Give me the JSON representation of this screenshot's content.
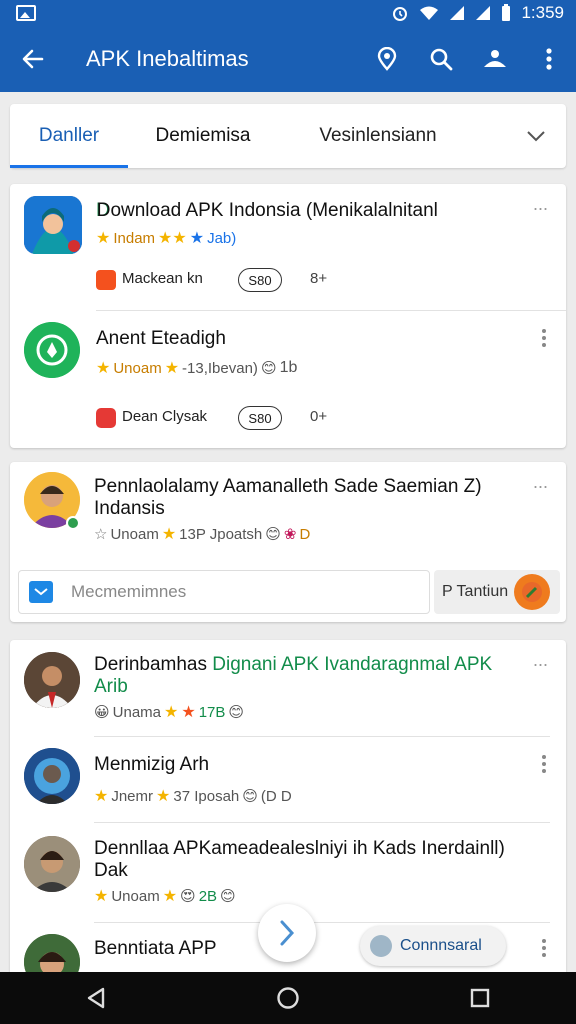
{
  "status_bar": {
    "time": "1:359"
  },
  "app_bar": {
    "title": "APK Inebaltimas"
  },
  "tabs": [
    {
      "label": "Danller"
    },
    {
      "label": "Demiemisa"
    },
    {
      "label": "Vesinlensiann"
    }
  ],
  "card1": {
    "item1": {
      "title": "Download APK Indonsia (Menikalalnitanl",
      "meta": "Indam",
      "meta_value": "Jab)",
      "row_label": "Mackean  kn",
      "pill": "S80",
      "count": "8+"
    },
    "item2": {
      "title": "Anent Eteadigh",
      "meta": "Unoam",
      "meta_value": "-13,Ibevan)",
      "meta_extra": "1b",
      "row_label": "Dean Clysak",
      "pill": "S80",
      "count": "0+"
    }
  },
  "card2": {
    "title_line1": "Pennlaolalamy Aamanalleth Sade Saemian Z)",
    "title_line2": "Indansis",
    "meta": "Unoam",
    "meta_value": "13P Jpoatsh",
    "meta_extra": "D",
    "compose_placeholder": "Mecmemimnes",
    "send_label": "P Tantiun"
  },
  "card3": {
    "item1": {
      "title_dark": "Derinbamhas",
      "title_green": "Dignani APK Ivandaragnmal APK",
      "title_line2": "Arib",
      "meta": "Unama",
      "meta_value": "17B"
    },
    "item2": {
      "title": "Menmizig Arh",
      "meta": "Jnemr",
      "meta_value": "37 Iposah",
      "meta_extra": "(D D"
    },
    "item3": {
      "title_line1": "Dennllaa APKameadealeslniyi ih Kads Inerdainll)",
      "title_line2": "Dak",
      "meta": "Unoam",
      "meta_value": "2B"
    },
    "item4": {
      "title": "Benntiata APP"
    }
  },
  "chip": {
    "label": "Connnsaral"
  },
  "colors": {
    "primary": "#1a5fb4",
    "accent": "#1a73e8",
    "green": "#128c4a",
    "star": "#f4b400"
  }
}
